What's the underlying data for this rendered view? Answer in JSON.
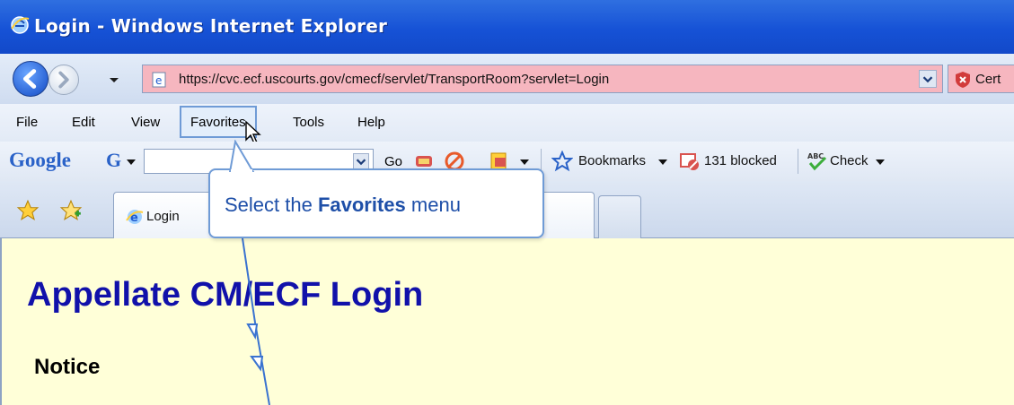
{
  "window": {
    "title": "Login - Windows Internet Explorer"
  },
  "address_bar": {
    "url": "https://cvc.ecf.uscourts.gov/cmecf/servlet/TransportRoom?servlet=Login",
    "security_label": "Cert"
  },
  "menu": {
    "items": [
      "File",
      "Edit",
      "View",
      "Favorites",
      "Tools",
      "Help"
    ],
    "active": "Favorites"
  },
  "google_toolbar": {
    "logo": "Google",
    "g_button": "G",
    "go_label": "Go",
    "bookmarks_label": "Bookmarks",
    "blocked_label": "131 blocked",
    "check_label": "Check"
  },
  "tabs": [
    {
      "label": "Login"
    }
  ],
  "callout": {
    "prefix": "Select the ",
    "emphasis": "Favorites",
    "suffix": " menu"
  },
  "page": {
    "heading": "Appellate CM/ECF Login",
    "subheading": "Notice"
  },
  "colors": {
    "titlebar": "#1652d6",
    "address_error_bg": "#f6b6bf",
    "content_bg": "#ffffd8",
    "heading": "#1111aa",
    "callout_text": "#1e4fa8"
  }
}
